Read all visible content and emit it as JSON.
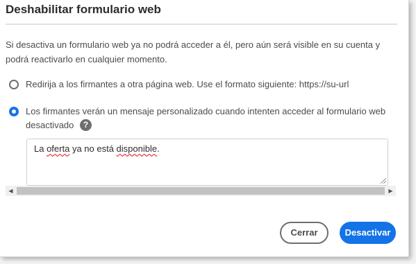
{
  "dialog": {
    "title": "Deshabilitar formulario web",
    "description": "Si desactiva un formulario web ya no podrá acceder a él, pero aún será visible en su cuenta y podrá reactivarlo en cualquier momento."
  },
  "options": [
    {
      "label": "Redirija a los firmantes a otra página web. Use el formato siguiente: https://su-url",
      "selected": false
    },
    {
      "label_line1": "Los firmantes verán un mensaje personalizado cuando intenten acceder al formulario web",
      "label_line2": "desactivado",
      "selected": true,
      "help_icon": "help-circle-icon",
      "help_glyph": "?"
    }
  ],
  "message": {
    "part1": "La ",
    "word1": "oferta",
    "part2": " ya no está ",
    "word2": "disponible",
    "part3": "."
  },
  "scrollbar": {
    "left_arrow": "◀",
    "right_arrow": "▶"
  },
  "buttons": {
    "cancel": "Cerrar",
    "primary": "Desactivar"
  },
  "colors": {
    "accent": "#1473e6",
    "text": "#4b4b4b",
    "spellcheck": "#e34850"
  }
}
